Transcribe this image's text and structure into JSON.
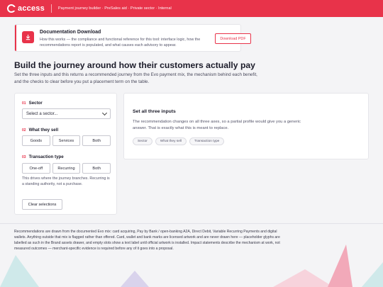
{
  "header": {
    "brand": "access",
    "breadcrumb": "Payment journey builder · PreSales aid · Private sector · Internal"
  },
  "banner": {
    "title": "Documentation Download",
    "description": "How this works — the compliance and functional reference for this tool: interface logic, how the recommendations report is populated, and what causes each advisory to appear.",
    "button_label": "Download PDF",
    "icon": "download-icon"
  },
  "page": {
    "title": "Build the journey around how their customers actually pay",
    "lead": "Set the three inputs and this returns a recommended journey from the Evo payment mix, the mechanism behind each benefit, and the checks to clear before you put a placement term on the table."
  },
  "form": {
    "sector": {
      "num": "01",
      "label": "Sector",
      "value": "Select a sector..."
    },
    "what_they_sell": {
      "num": "02",
      "label": "What they sell",
      "options": [
        "Goods",
        "Services",
        "Both"
      ]
    },
    "transaction_type": {
      "num": "03",
      "label": "Transaction type",
      "options": [
        "One-off",
        "Recurring",
        "Both"
      ]
    },
    "hint": "This drives where the journey branches. Recurring is a standing authority, not a purchase.",
    "clear_label": "Clear selections"
  },
  "result": {
    "title": "Set all three inputs",
    "description": "The recommendation changes on all three axes, so a partial profile would give you a generic answer. That is exactly what this is meant to replace.",
    "chips": [
      "Sector",
      "What they sell",
      "Transaction type"
    ]
  },
  "footnote": "Recommendations are drawn from the documented Evo mix: card acquiring, Pay by Bank / open-banking A2A, Direct Debit, Variable Recurring Payments and digital wallets. Anything outside that mix is flagged rather than offered. Card, wallet and bank marks are licensed artwork and are never drawn here — placeholder glyphs are labelled as such in the Brand assets drawer, and empty slots show a text label until official artwork is installed. Impact statements describe the mechanism at work, not measured outcomes — merchant-specific evidence is required before any of it goes into a proposal.",
  "colors": {
    "accent": "#e8334a",
    "deco_teal": "#cfe9ea",
    "deco_pink": "#f2a9b9",
    "deco_pink_light": "#f7d3dc",
    "deco_lavender": "#d9d3ec"
  }
}
